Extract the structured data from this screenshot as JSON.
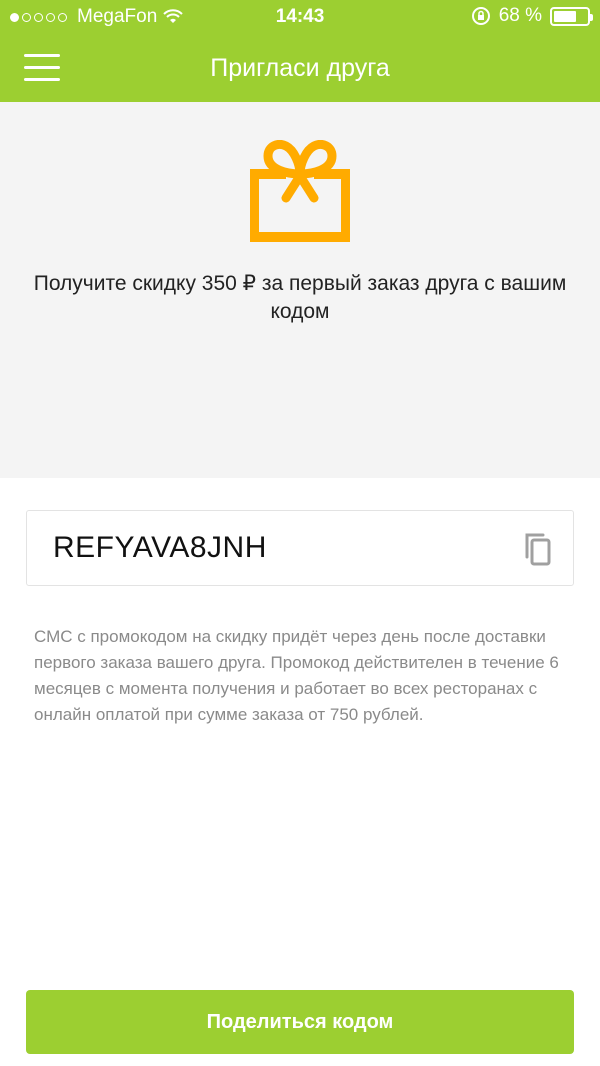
{
  "status_bar": {
    "carrier": "MegaFon",
    "time": "14:43",
    "battery_text": "68 %",
    "battery_level": 0.68
  },
  "header": {
    "title": "Пригласи друга"
  },
  "hero": {
    "text": "Получите скидку 350 ₽ за первый заказ друга с вашим кодом"
  },
  "promo": {
    "code": "REFYAVA8JNH"
  },
  "note": {
    "text": "СМС с промокодом на скидку придёт через день после доставки первого заказа вашего друга. Промокод действителен в течение 6 месяцев с момента получения и работает во всех ресторанах с онлайн оплатой при сумме заказа от 750 рублей."
  },
  "actions": {
    "share_label": "Поделиться кодом"
  },
  "colors": {
    "accent_green": "#9ccf31",
    "gift_orange": "#ffab00",
    "hero_bg": "#f4f4f4"
  }
}
